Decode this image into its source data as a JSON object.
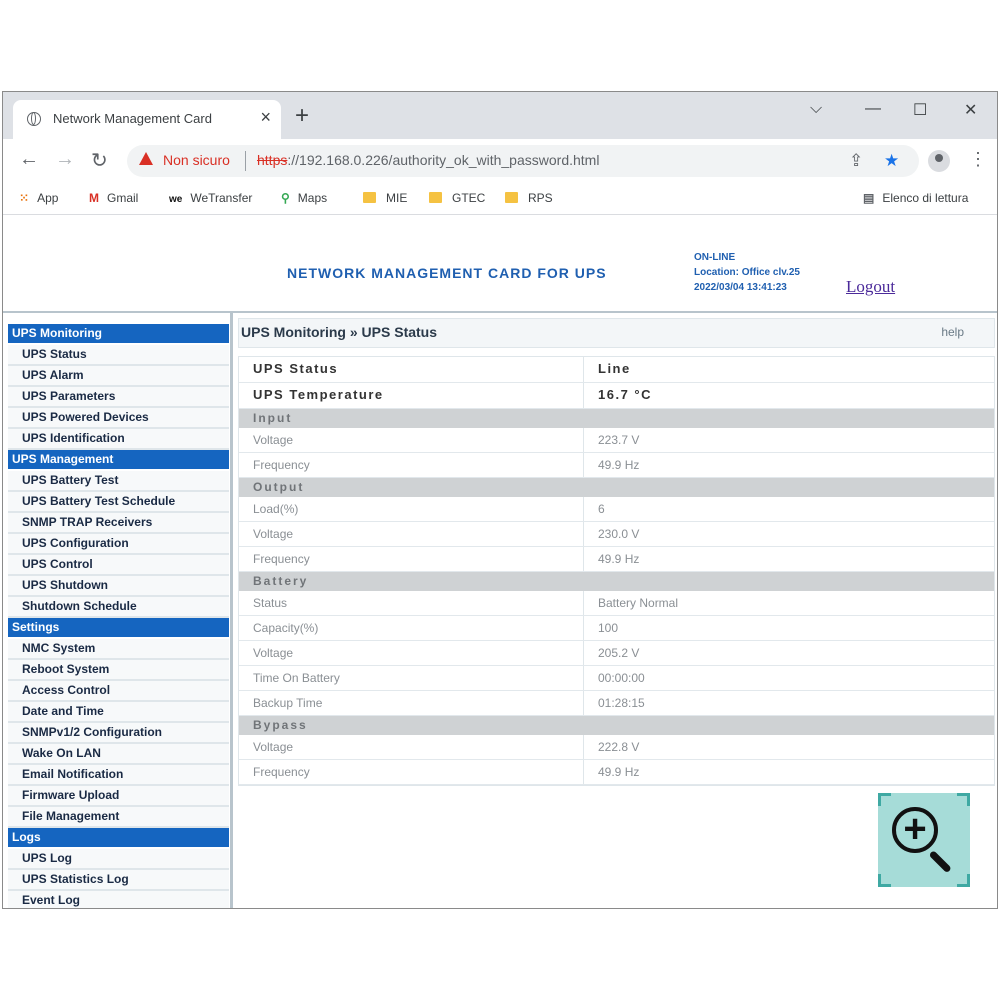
{
  "browser": {
    "tab_title": "Network Management Card",
    "url_warning": "Non sicuro",
    "url_scheme": "https",
    "url_rest": "://192.168.0.226/authority_ok_with_password.html",
    "bookmarks": [
      {
        "label": "App",
        "icon": "apps-grid-icon"
      },
      {
        "label": "Gmail",
        "icon": "gmail-icon"
      },
      {
        "label": "WeTransfer",
        "icon": "wetransfer-icon"
      },
      {
        "label": "Maps",
        "icon": "maps-pin-icon"
      },
      {
        "label": "MIE",
        "icon": "folder-icon"
      },
      {
        "label": "GTEC",
        "icon": "folder-icon"
      },
      {
        "label": "RPS",
        "icon": "folder-icon"
      }
    ],
    "reading_list": "Elenco di lettura"
  },
  "header": {
    "title": "NETWORK MANAGEMENT CARD FOR UPS",
    "status": "ON-LINE",
    "location": "Location: Office clv.25",
    "datetime": "2022/03/04 13:41:23",
    "logout": "Logout"
  },
  "sidebar": {
    "sections": [
      {
        "title": "UPS Monitoring",
        "items": [
          "UPS Status",
          "UPS Alarm",
          "UPS Parameters",
          "UPS Powered Devices",
          "UPS Identification"
        ]
      },
      {
        "title": "UPS Management",
        "items": [
          "UPS Battery Test",
          "UPS Battery Test Schedule",
          "SNMP TRAP Receivers",
          "UPS Configuration",
          "UPS Control",
          "UPS Shutdown",
          "Shutdown Schedule"
        ]
      },
      {
        "title": "Settings",
        "items": [
          "NMC System",
          "Reboot System",
          "Access Control",
          "Date and Time",
          "SNMPv1/2 Configuration",
          "Wake On LAN",
          "Email Notification",
          "Firmware Upload",
          "File Management"
        ]
      },
      {
        "title": "Logs",
        "items": [
          "UPS Log",
          "UPS Statistics Log",
          "Event Log"
        ]
      }
    ]
  },
  "main": {
    "breadcrumb": "UPS Monitoring » UPS Status",
    "help": "help",
    "top_rows": [
      {
        "label": "UPS Status",
        "value": "Line"
      },
      {
        "label": "UPS Temperature",
        "value": "16.7 °C"
      }
    ],
    "sections": [
      {
        "title": "Input",
        "rows": [
          {
            "label": "Voltage",
            "value": "223.7 V"
          },
          {
            "label": "Frequency",
            "value": "49.9 Hz"
          }
        ]
      },
      {
        "title": "Output",
        "rows": [
          {
            "label": "Load(%)",
            "value": "6"
          },
          {
            "label": "Voltage",
            "value": "230.0 V"
          },
          {
            "label": "Frequency",
            "value": "49.9 Hz"
          }
        ]
      },
      {
        "title": "Battery",
        "rows": [
          {
            "label": "Status",
            "value": "Battery Normal"
          },
          {
            "label": "Capacity(%)",
            "value": "100"
          },
          {
            "label": "Voltage",
            "value": "205.2 V"
          },
          {
            "label": "Time On Battery",
            "value": "00:00:00"
          },
          {
            "label": "Backup Time",
            "value": "01:28:15"
          }
        ]
      },
      {
        "title": "Bypass",
        "rows": [
          {
            "label": "Voltage",
            "value": "222.8 V"
          },
          {
            "label": "Frequency",
            "value": "49.9 Hz"
          }
        ]
      }
    ]
  },
  "colors": {
    "accent": "#1565c0",
    "header_text": "#1f5fb0",
    "warning": "#d93025",
    "zoom_bg": "#a6dcd8"
  }
}
